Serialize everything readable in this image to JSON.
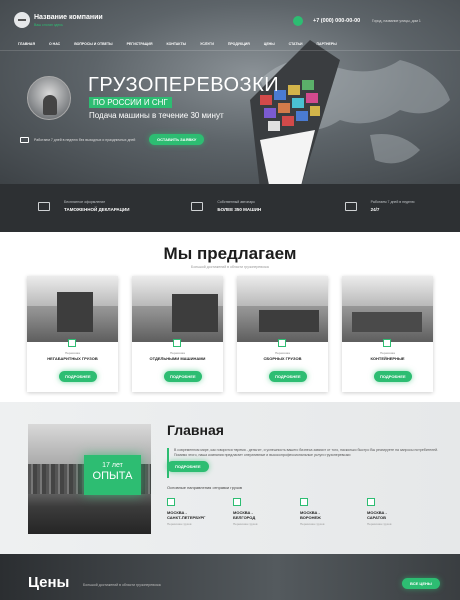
{
  "header": {
    "company_name": "Название компании",
    "slogan": "Ваш слоган здесь",
    "phone": "+7 (000) 000-00-00",
    "callback": "Город, название улицы, дом 1"
  },
  "nav": {
    "items": [
      "ГЛАВНАЯ",
      "О НАС",
      "ВОПРОСЫ И ОТВЕТЫ",
      "РЕГИСТРАЦИЯ",
      "КОНТАКТЫ",
      "УСЛУГИ",
      "ПРОДУКЦИЯ",
      "ЦЕНЫ",
      "СТАТЬИ",
      "ПАРТНЕРЫ"
    ]
  },
  "hero": {
    "title": "ГРУЗОПЕРЕВОЗКИ",
    "subtitle": "ПО РОССИИ И СНГ",
    "description": "Подача машины в течение 30 минут",
    "small_text": "Работаем 7 дней в неделю без выходных и праздничных дней",
    "button": "ОСТАВИТЬ ЗАЯВКУ"
  },
  "features": [
    {
      "icon": "document-icon",
      "line1": "Бесплатное оформление",
      "line2": "ТАМОЖЕННОЙ ДЕКЛАРАЦИИ"
    },
    {
      "icon": "truck-icon",
      "line1": "Собственный автопарк",
      "line2": "БОЛЕЕ 350 МАШИН"
    },
    {
      "icon": "clock-icon",
      "line1": "Работаем 7 дней в неделю",
      "line2": "24/7"
    }
  ],
  "offer": {
    "title": "Мы предлагаем",
    "subtitle": "Большой достижений в области грузоперевозок",
    "cards": [
      {
        "caption": "Перевозка",
        "name": "НЕГАБАРИТНЫХ ГРУЗОВ",
        "button": "ПОДРОБНЕЕ"
      },
      {
        "caption": "Перевозка",
        "name": "ОТДЕЛЬНЫМИ МАШИНАМИ",
        "button": "ПОДРОБНЕЕ"
      },
      {
        "caption": "Перевозка",
        "name": "СБОРНЫХ ГРУЗОВ",
        "button": "ПОДРОБНЕЕ"
      },
      {
        "caption": "Перевозка",
        "name": "КОНТЕЙНЕРНЫЕ",
        "button": "ПОДРОБНЕЕ"
      }
    ]
  },
  "main": {
    "title": "Главная",
    "text": "В современном мире, как говорится «время - деньги», и успешность вашего бизнеса зависит от того, насколько быстро Вы реагируете на запросы потребителей. Помимо этого, наша компания предлагает оперативные и высокопрофессиональные услуги грузоперевозки",
    "button": "ПОДРОБНЕЕ",
    "experience_years": "17 лет",
    "experience_label": "ОПЫТА",
    "directions_title": "Основные направления отправки грузов",
    "routes": [
      {
        "line1": "МОСКВА -",
        "line2": "САНКТ-ПЕТЕРБУРГ",
        "note": "Перевозка грузов"
      },
      {
        "line1": "МОСКВА -",
        "line2": "БЕЛГОРОД",
        "note": "Перевозка грузов"
      },
      {
        "line1": "МОСКВА -",
        "line2": "ВОРОНЕЖ",
        "note": "Перевозка грузов"
      },
      {
        "line1": "МОСКВА -",
        "line2": "САРАТОВ",
        "note": "Перевозка грузов"
      }
    ]
  },
  "prices": {
    "title": "Цены",
    "subtitle": "Большой достижений в области грузоперевозок",
    "button": "ВСЕ ЦЕНЫ"
  },
  "colors": {
    "accent": "#2dbd72",
    "dark": "#2d3033"
  }
}
